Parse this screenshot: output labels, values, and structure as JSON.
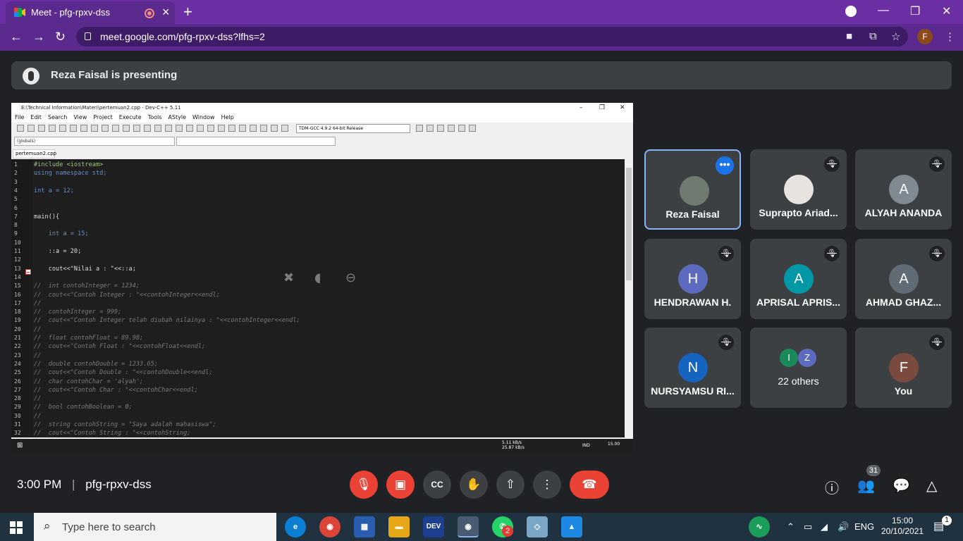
{
  "browser": {
    "tab_title": "Meet - pfg-rpxv-dss",
    "url": "meet.google.com/pfg-rpxv-dss?lfhs=2",
    "profile_initial": "F",
    "accent": "#6b2fa3"
  },
  "banner": {
    "text": "Reza Faisal is presenting"
  },
  "devcpp": {
    "title": "E:\\Technical Information\\Materi\\pertemuan2.cpp - Dev-C++ 5.11",
    "menu": [
      "File",
      "Edit",
      "Search",
      "View",
      "Project",
      "Execute",
      "Tools",
      "AStyle",
      "Window",
      "Help"
    ],
    "compiler": "TDM-GCC 4.9.2 64-bit Release",
    "scope_combo": "(globals)",
    "file_tab": "pertemuan2.cpp",
    "lines": [
      {
        "n": "1",
        "text": "#include <iostream>",
        "cls": "pp"
      },
      {
        "n": "2",
        "text": "using namespace std;",
        "cls": "kw"
      },
      {
        "n": "3",
        "text": "",
        "cls": ""
      },
      {
        "n": "4",
        "text": "int a = 12;",
        "cls": "kw"
      },
      {
        "n": "5",
        "text": "",
        "cls": ""
      },
      {
        "n": "6",
        "text": "",
        "cls": ""
      },
      {
        "n": "7",
        "text": "main(){",
        "cls": ""
      },
      {
        "n": "8",
        "text": "",
        "cls": ""
      },
      {
        "n": "9",
        "text": "    int a = 15;",
        "cls": "kw"
      },
      {
        "n": "10",
        "text": "",
        "cls": ""
      },
      {
        "n": "11",
        "text": "    ::a = 20;",
        "cls": ""
      },
      {
        "n": "12",
        "text": "",
        "cls": ""
      },
      {
        "n": "13",
        "text": "    cout<<\"Nilai a : \"<<::a;",
        "cls": ""
      },
      {
        "n": "14",
        "text": "",
        "cls": ""
      },
      {
        "n": "15",
        "text": "//  int contohInteger = 1234;",
        "cls": "cm"
      },
      {
        "n": "16",
        "text": "//  cout<<\"Contoh Integer : \"<<contohInteger<<endl;",
        "cls": "cm"
      },
      {
        "n": "17",
        "text": "//",
        "cls": "cm"
      },
      {
        "n": "18",
        "text": "//  contohInteger = 999;",
        "cls": "cm"
      },
      {
        "n": "19",
        "text": "//  cout<<\"Contoh Integer telah diubah nilainya : \"<<contohInteger<<endl;",
        "cls": "cm"
      },
      {
        "n": "20",
        "text": "//",
        "cls": "cm"
      },
      {
        "n": "21",
        "text": "//  float contohFloat = 89.98;",
        "cls": "cm"
      },
      {
        "n": "22",
        "text": "//  cout<<\"Contoh Float : \"<<contohFloat<<endl;",
        "cls": "cm"
      },
      {
        "n": "23",
        "text": "//",
        "cls": "cm"
      },
      {
        "n": "24",
        "text": "//  double contohDouble = 1233.65;",
        "cls": "cm"
      },
      {
        "n": "25",
        "text": "//  cout<<\"Contoh Double : \"<<contohDouble<<endl;",
        "cls": "cm"
      },
      {
        "n": "26",
        "text": "//  char contohChar = 'alyah';",
        "cls": "cm"
      },
      {
        "n": "27",
        "text": "//  cout<<\"Contoh Char : \"<<contohChar<<endl;",
        "cls": "cm"
      },
      {
        "n": "28",
        "text": "//",
        "cls": "cm"
      },
      {
        "n": "29",
        "text": "//  bool contohBoolean = 0;",
        "cls": "cm"
      },
      {
        "n": "30",
        "text": "//",
        "cls": "cm"
      },
      {
        "n": "31",
        "text": "//  string contohString = \"Saya adalah mahasiswa\";",
        "cls": "cm"
      },
      {
        "n": "32",
        "text": "//  cout<<\"Contoh String : \"<<contohString;",
        "cls": "cm"
      }
    ],
    "task_net": "5.11 kB/s  25.87 kB/s",
    "task_lang": "IND",
    "task_time": "15.00"
  },
  "participants": [
    {
      "name": "Reza Faisal",
      "initial": "",
      "color": "#6f7a70",
      "state": "more",
      "active": true
    },
    {
      "name": "Suprapto Ariad...",
      "initial": "",
      "color": "#e8e3df",
      "state": "muted",
      "active": false
    },
    {
      "name": "ALYAH ANANDA",
      "initial": "A",
      "color": "#7f8a93",
      "state": "muted",
      "active": false
    },
    {
      "name": "HENDRAWAN H.",
      "initial": "H",
      "color": "#5c6bc0",
      "state": "muted",
      "active": false
    },
    {
      "name": "APRISAL APRIS...",
      "initial": "A",
      "color": "#0097a7",
      "state": "muted",
      "active": false
    },
    {
      "name": "AHMAD GHAZ...",
      "initial": "A",
      "color": "#5f6b75",
      "state": "muted",
      "active": false
    },
    {
      "name": "NURSYAMSU RI...",
      "initial": "N",
      "color": "#1565c0",
      "state": "muted",
      "active": false
    },
    {
      "name": "22 others",
      "initial": "",
      "color": "",
      "state": "none",
      "active": false
    },
    {
      "name": "You",
      "initial": "F",
      "color": "#7b4a3f",
      "state": "muted",
      "active": false
    }
  ],
  "others_avatars": [
    "I",
    "Z"
  ],
  "meeting": {
    "time": "3:00 PM",
    "code": "pfg-rpxv-dss",
    "people_count": "31"
  },
  "taskbar": {
    "search_placeholder": "Type here to search",
    "lang": "ENG",
    "time": "15:00",
    "date": "20/10/2021",
    "notify_count": "1",
    "whatsapp_badge": "2"
  }
}
